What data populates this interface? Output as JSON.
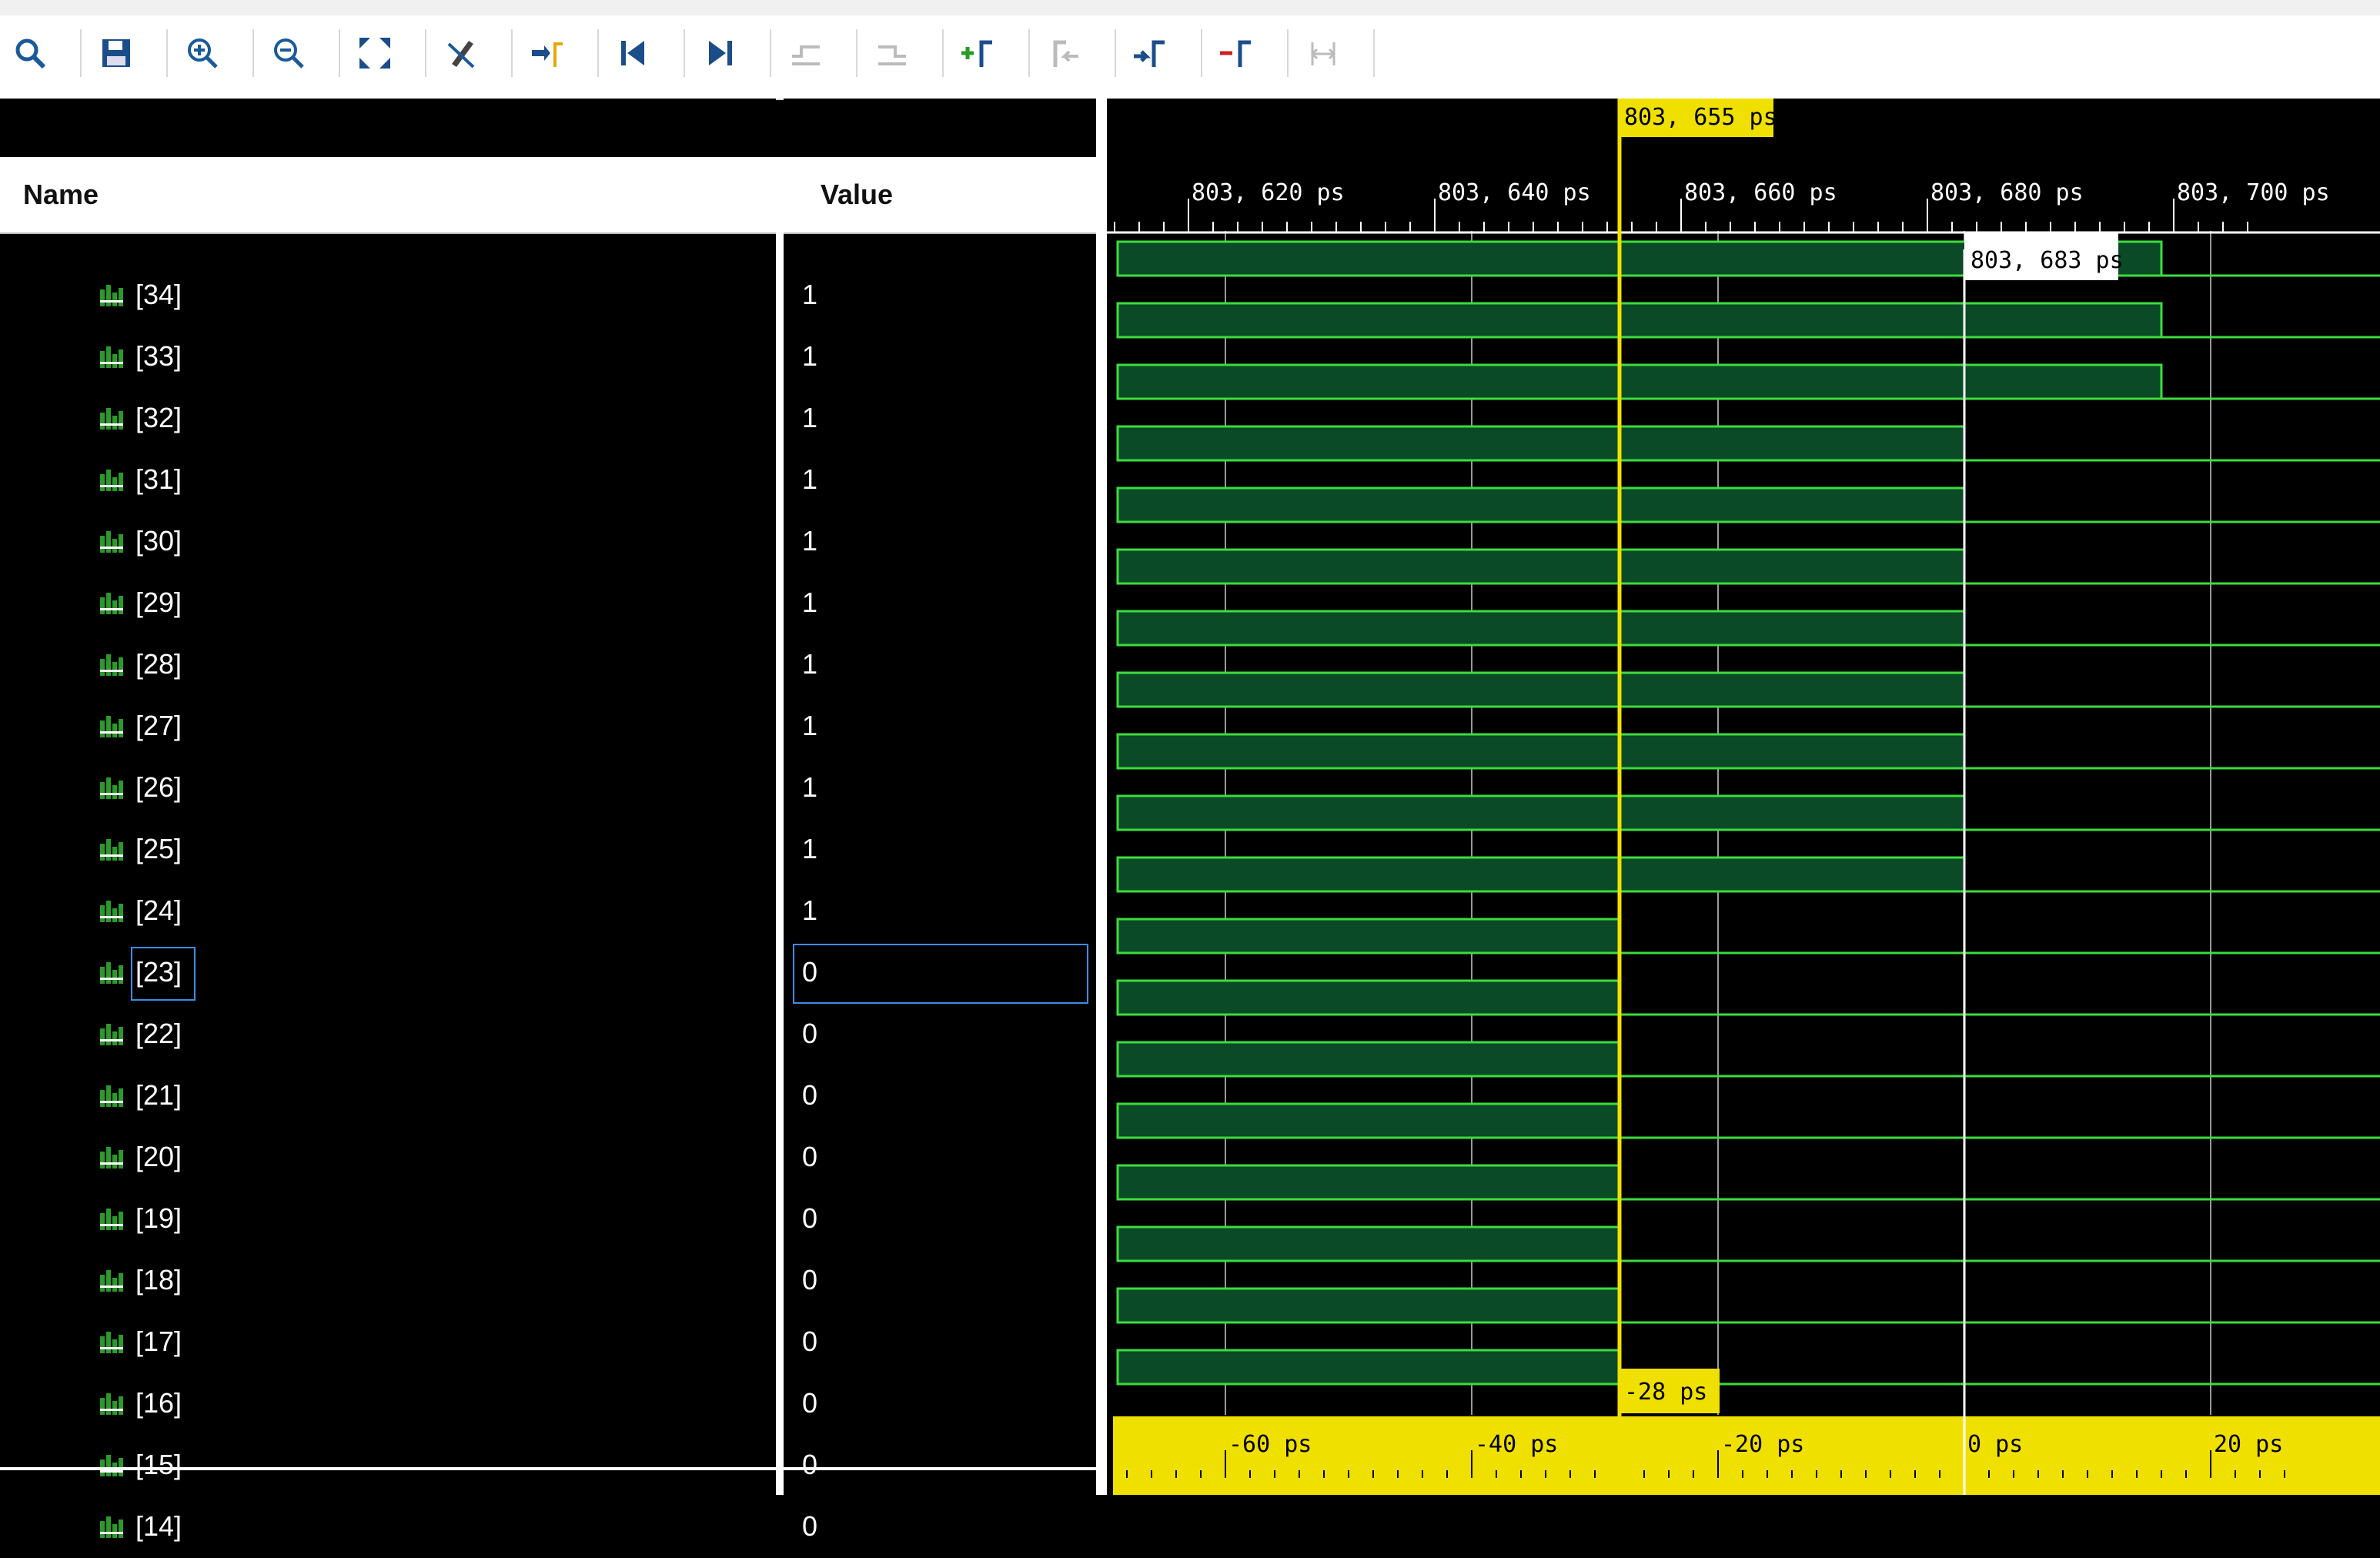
{
  "toolbar": {
    "buttons": [
      {
        "id": "search",
        "icon": "search-icon"
      },
      {
        "id": "save",
        "icon": "save-icon"
      },
      {
        "id": "zoom-in",
        "icon": "zoom-in-icon"
      },
      {
        "id": "zoom-out",
        "icon": "zoom-out-icon"
      },
      {
        "id": "zoom-fit",
        "icon": "zoom-fit-icon"
      },
      {
        "id": "cursor-off",
        "icon": "pencil-cross-icon"
      },
      {
        "id": "goto-cursor",
        "icon": "goto-cursor-icon"
      },
      {
        "id": "goto-start",
        "icon": "goto-start-icon"
      },
      {
        "id": "goto-end",
        "icon": "goto-end-icon"
      },
      {
        "id": "prev-transition",
        "icon": "prev-transition-icon"
      },
      {
        "id": "next-transition",
        "icon": "next-transition-icon"
      },
      {
        "id": "add-marker",
        "icon": "add-marker-icon"
      },
      {
        "id": "prev-marker",
        "icon": "prev-marker-icon"
      },
      {
        "id": "next-marker",
        "icon": "next-marker-icon"
      },
      {
        "id": "remove-marker",
        "icon": "remove-marker-icon"
      },
      {
        "id": "swap-cursors",
        "icon": "swap-cursors-icon"
      }
    ]
  },
  "columns": {
    "name": "Name",
    "value": "Value"
  },
  "signals": [
    {
      "name": "[34]",
      "value": "1",
      "high_until": 3
    },
    {
      "name": "[33]",
      "value": "1",
      "high_until": 3
    },
    {
      "name": "[32]",
      "value": "1",
      "high_until": 3
    },
    {
      "name": "[31]",
      "value": "1",
      "high_until": 2
    },
    {
      "name": "[30]",
      "value": "1",
      "high_until": 2
    },
    {
      "name": "[29]",
      "value": "1",
      "high_until": 2
    },
    {
      "name": "[28]",
      "value": "1",
      "high_until": 2
    },
    {
      "name": "[27]",
      "value": "1",
      "high_until": 2
    },
    {
      "name": "[26]",
      "value": "1",
      "high_until": 2
    },
    {
      "name": "[25]",
      "value": "1",
      "high_until": 2
    },
    {
      "name": "[24]",
      "value": "1",
      "high_until": 2
    },
    {
      "name": "[23]",
      "value": "0",
      "high_until": 1
    },
    {
      "name": "[22]",
      "value": "0",
      "high_until": 1
    },
    {
      "name": "[21]",
      "value": "0",
      "high_until": 1
    },
    {
      "name": "[20]",
      "value": "0",
      "high_until": 1
    },
    {
      "name": "[19]",
      "value": "0",
      "high_until": 1
    },
    {
      "name": "[18]",
      "value": "0",
      "high_until": 1
    },
    {
      "name": "[17]",
      "value": "0",
      "high_until": 1
    },
    {
      "name": "[16]",
      "value": "0",
      "high_until": 1
    },
    {
      "name": "[15]",
      "value": "0",
      "high_until": 0
    },
    {
      "name": "[14]",
      "value": "0",
      "high_until": 0
    }
  ],
  "selected_signal": "[23]",
  "timeline": {
    "top_ticks": [
      "803, 620 ps",
      "803, 640 ps",
      "803, 660 ps",
      "803, 680 ps",
      "803, 700 ps"
    ],
    "bottom_ticks": [
      "-60 ps",
      "-40 ps",
      "-20 ps",
      "0 ps",
      "20 ps"
    ],
    "main_cursor": "803, 655 ps",
    "secondary_cursor": "803, 683 ps",
    "delta": "-28 ps"
  },
  "colors": {
    "wave_high": "#0a4a26",
    "wave_edge": "#3ddc3d",
    "cursor": "#f0e000",
    "grid": "#9a9a9a"
  }
}
